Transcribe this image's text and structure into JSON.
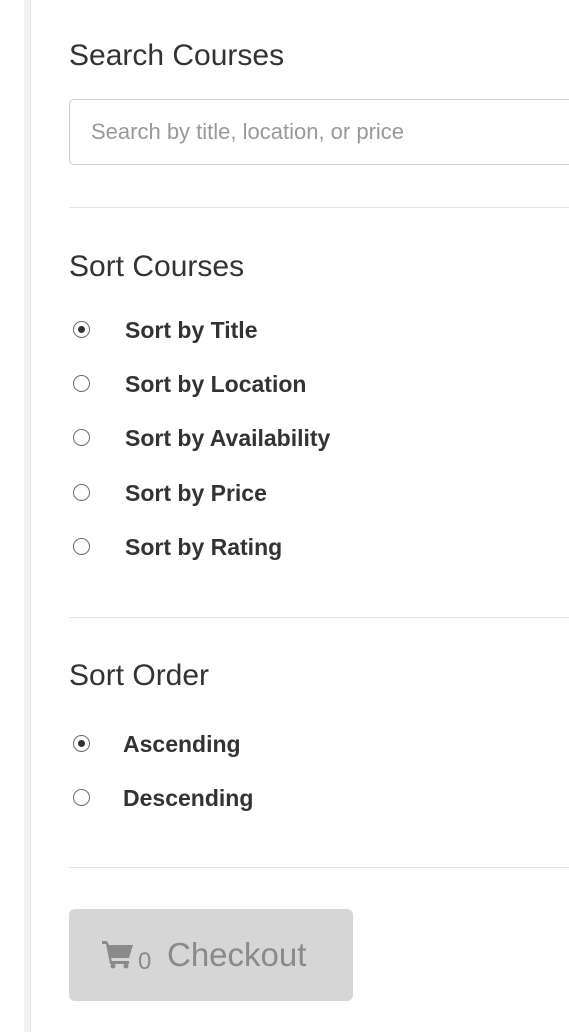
{
  "search": {
    "title": "Search Courses",
    "placeholder": "Search by title, location, or price",
    "value": ""
  },
  "sort": {
    "title": "Sort Courses",
    "options": [
      {
        "label": "Sort by Title",
        "checked": true
      },
      {
        "label": "Sort by Location",
        "checked": false
      },
      {
        "label": "Sort by Availability",
        "checked": false
      },
      {
        "label": "Sort by Price",
        "checked": false
      },
      {
        "label": "Sort by Rating",
        "checked": false
      }
    ]
  },
  "order": {
    "title": "Sort Order",
    "options": [
      {
        "label": "Ascending",
        "checked": true
      },
      {
        "label": "Descending",
        "checked": false
      }
    ]
  },
  "checkout": {
    "icon": "shopping-cart-icon",
    "count": "0",
    "label": "Checkout",
    "disabled": true
  },
  "colors": {
    "text": "#333333",
    "placeholder": "#999999",
    "button_bg": "#d6d6d6",
    "button_text": "#8a8a8a",
    "divider": "#e5e5e5"
  }
}
